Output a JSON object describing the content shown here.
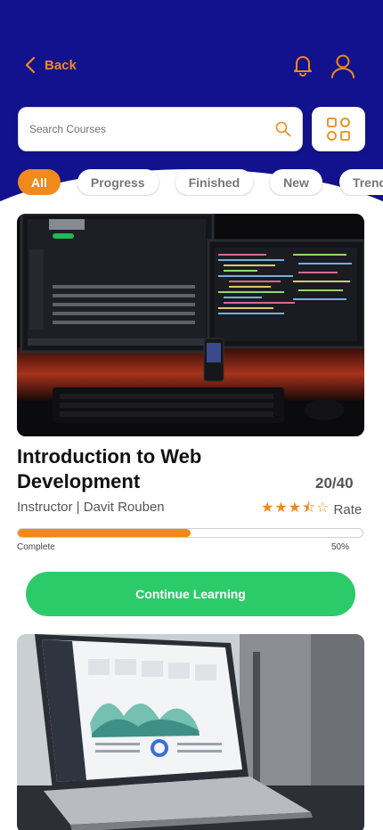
{
  "header": {
    "back_label": "Back",
    "search_placeholder": "Search Courses",
    "icons": [
      "chevron-left-icon",
      "bell-icon",
      "user-icon",
      "search-icon",
      "grid-icon"
    ]
  },
  "tabs": [
    {
      "label": "All",
      "active": true
    },
    {
      "label": "Progress",
      "active": false
    },
    {
      "label": "Finished",
      "active": false
    },
    {
      "label": "New",
      "active": false
    },
    {
      "label": "Trending",
      "active": false
    }
  ],
  "course": {
    "title": "Introduction to Web Development",
    "score": "20/40",
    "instructor": "Instructor | Davit Rouben",
    "rating_stars": "★★★⯪☆",
    "rating_value": 3.5,
    "rating_label": "Rate",
    "progress_label": "Complete",
    "progress_percent": "50%",
    "progress_value": 0.5,
    "cta": "Continue Learning"
  },
  "colors": {
    "header": "#13128e",
    "accent": "#f08a1a",
    "cta": "#2ccb69"
  }
}
